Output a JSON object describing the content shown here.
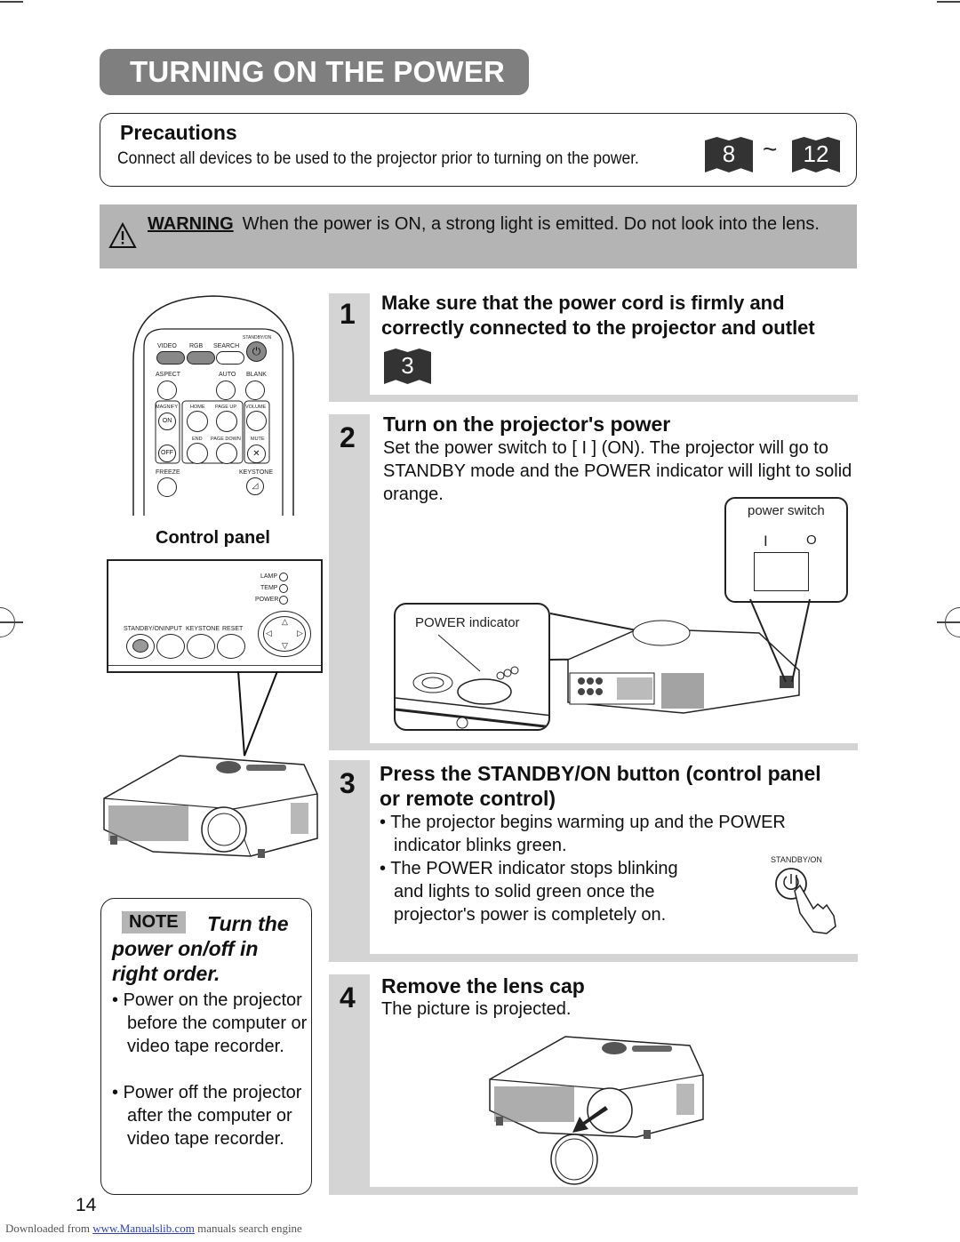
{
  "page": {
    "title": "TURNING ON THE POWER",
    "page_number": "14"
  },
  "precautions": {
    "title": "Precautions",
    "text": "Connect all devices to be used to the projector prior to turning on the power.",
    "ref_from": "8",
    "ref_sep": "~",
    "ref_to": "12"
  },
  "warning": {
    "label": "WARNING",
    "text": "When the power is ON, a strong light is emitted. Do not look into the lens."
  },
  "remote": {
    "buttons": {
      "video": "VIDEO",
      "rgb": "RGB",
      "search": "SEARCH",
      "standby_on": "STANDBY/ON",
      "aspect": "ASPECT",
      "auto": "AUTO",
      "blank": "BLANK",
      "magnify": "MAGNIFY",
      "on": "ON",
      "off": "OFF",
      "home": "HOME",
      "page_up": "PAGE UP",
      "end": "END",
      "page_down": "PAGE DOWN",
      "volume": "VOLUME",
      "mute": "MUTE",
      "freeze": "FREEZE",
      "keystone": "KEYSTONE"
    }
  },
  "control_panel": {
    "title": "Control panel",
    "indicators": [
      "LAMP",
      "TEMP",
      "POWER"
    ],
    "buttons": [
      "STANDBY/ON",
      "INPUT",
      "KEYSTONE",
      "RESET"
    ]
  },
  "steps": [
    {
      "number": "1",
      "title": "Make sure that the power cord is firmly and correctly connected to the projector and outlet",
      "ref": "3"
    },
    {
      "number": "2",
      "title": "Turn on the projector's power",
      "text": "Set the power switch to [ I ] (ON). The projector will go to STANDBY mode and the POWER indicator will light to solid orange.",
      "callouts": {
        "power_switch": "power switch",
        "power_indicator": "POWER indicator",
        "switch_on": "I",
        "switch_off": "O"
      }
    },
    {
      "number": "3",
      "title": "Press the STANDBY/ON button (control panel or remote control)",
      "bullets": [
        "The projector begins warming up and the POWER indicator blinks green.",
        "The POWER indicator stops blinking and lights to solid green once the projector's power is completely on."
      ],
      "button_label": "STANDBY/ON"
    },
    {
      "number": "4",
      "title": "Remove the lens cap",
      "text": "The picture is projected."
    }
  ],
  "note": {
    "badge": "NOTE",
    "heading": "Turn the power on/off in right order.",
    "bullets": [
      "Power on the projector before the computer or video tape recorder.",
      "Power off the projector after the computer or video tape recorder."
    ]
  },
  "footer": {
    "prefix": "Downloaded from",
    "link": "www.Manualslib.com",
    "suffix": "manuals search engine"
  }
}
